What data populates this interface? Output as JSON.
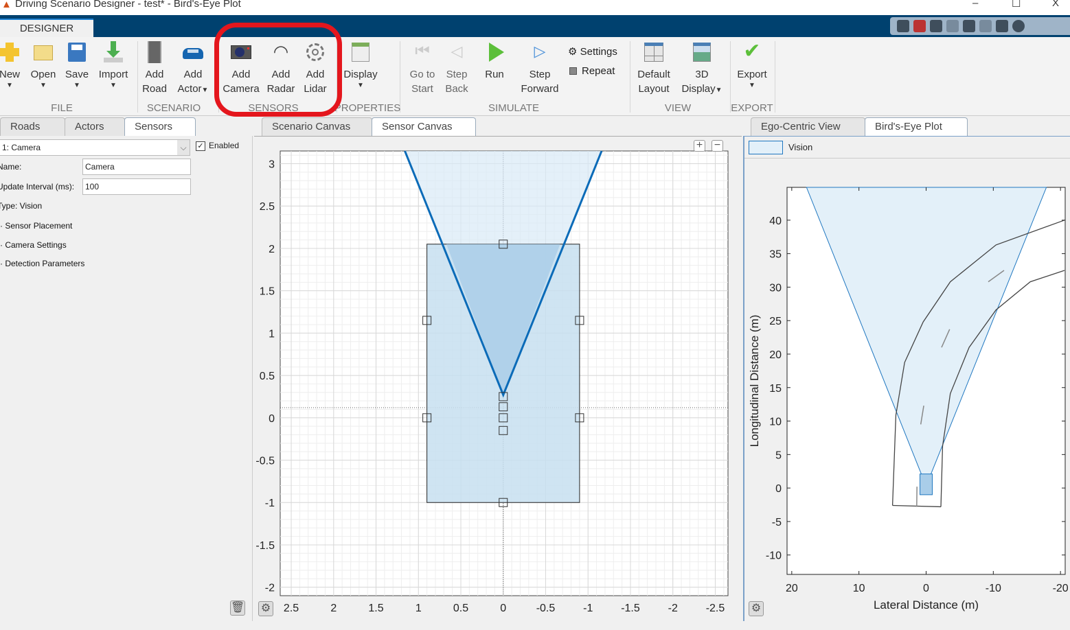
{
  "window": {
    "title": "Driving Scenario Designer - test* - Bird's-Eye Plot",
    "minimize": "–",
    "maximize": "☐",
    "close": "X"
  },
  "ribbon": {
    "tab": "DESIGNER",
    "buttons": {
      "new": "New",
      "open": "Open",
      "save": "Save",
      "import": "Import",
      "add_road_1": "Add",
      "add_road_2": "Road",
      "add_actor_1": "Add",
      "add_actor_2": "Actor",
      "add_camera_1": "Add",
      "add_camera_2": "Camera",
      "add_radar_1": "Add",
      "add_radar_2": "Radar",
      "add_lidar_1": "Add",
      "add_lidar_2": "Lidar",
      "display": "Display",
      "go_start_1": "Go to",
      "go_start_2": "Start",
      "step_back_1": "Step",
      "step_back_2": "Back",
      "run": "Run",
      "step_fwd_1": "Step",
      "step_fwd_2": "Forward",
      "settings": "Settings",
      "repeat": "Repeat",
      "default_layout_1": "Default",
      "default_layout_2": "Layout",
      "display3d_1": "3D",
      "display3d_2": "Display",
      "export": "Export"
    },
    "sections": {
      "file": "FILE",
      "scenario": "SCENARIO",
      "sensors": "SENSORS",
      "properties": "PROPERTIES",
      "simulate": "SIMULATE",
      "view": "VIEW",
      "export": "EXPORT"
    },
    "repeat_checked": false
  },
  "left_panel": {
    "tabs": [
      "Roads",
      "Actors",
      "Sensors"
    ],
    "active_tab": "Sensors",
    "sensor_select": "1: Camera",
    "enabled_label": "Enabled",
    "enabled": true,
    "name_label": "Name:",
    "name_value": "Camera",
    "interval_label": "Update Interval (ms):",
    "interval_value": "100",
    "type_label": "Type: Vision",
    "sections": [
      "Sensor Placement",
      "Camera Settings",
      "Detection Parameters"
    ]
  },
  "center_panel": {
    "tabs": [
      "Scenario Canvas",
      "Sensor Canvas"
    ],
    "active_tab": "Sensor Canvas",
    "x_ticks": [
      2.5,
      2,
      1.5,
      1,
      0.5,
      0,
      -0.5,
      -1,
      -1.5,
      -2,
      -2.5
    ],
    "y_ticks": [
      3,
      2.5,
      2,
      1.5,
      1,
      0.5,
      0,
      -0.5,
      -1,
      -1.5,
      -2
    ],
    "xlim": [
      2.63,
      -2.65
    ],
    "ylim": [
      -2.1,
      3.15
    ],
    "ego_rect": {
      "x": [
        0.9,
        -0.9
      ],
      "y": [
        -1.0,
        2.05
      ]
    },
    "cone": {
      "apex": [
        0,
        0.27
      ],
      "top_left": [
        1.16,
        3.15
      ],
      "top_right": [
        -1.16,
        3.15
      ]
    },
    "handles": [
      [
        0,
        2.05
      ],
      [
        0.9,
        1.15
      ],
      [
        -0.9,
        1.15
      ],
      [
        0.9,
        0
      ],
      [
        -0.9,
        0
      ],
      [
        0,
        -1.0
      ],
      [
        0,
        0.25
      ],
      [
        0,
        0.13
      ],
      [
        0,
        0
      ],
      [
        0,
        -0.15
      ]
    ],
    "cone_color": "#0b6bb8",
    "rect_fill": "#c7dff0"
  },
  "right_panel": {
    "tabs": [
      "Ego-Centric View",
      "Bird's-Eye Plot"
    ],
    "active_tab": "Bird's-Eye Plot",
    "legend": "Vision",
    "chart_data": {
      "type": "line",
      "xlabel": "Lateral Distance (m)",
      "ylabel": "Longitudinal Distance (m)",
      "xlim": [
        20.7,
        -20.7
      ],
      "ylim": [
        -12.9,
        44.9
      ],
      "x_ticks": [
        20,
        10,
        0,
        -10,
        -20
      ],
      "y_ticks": [
        40,
        35,
        30,
        25,
        20,
        15,
        10,
        5,
        0,
        -5,
        -10
      ],
      "coverage": {
        "name": "Vision",
        "apex": [
          0,
          0.3
        ],
        "left": [
          17.8,
          44.9
        ],
        "right": [
          -17.9,
          44.9
        ],
        "fill": "#e3f0f9",
        "stroke": "#1f77c0"
      },
      "ego": {
        "x": [
          0.92,
          -0.92
        ],
        "y": [
          -1.0,
          2.1
        ]
      },
      "road_left": [
        [
          5.0,
          -2.6
        ],
        [
          4.5,
          10.9
        ],
        [
          3.2,
          18.75
        ],
        [
          0.44,
          24.8
        ],
        [
          -3.6,
          30.8
        ],
        [
          -10.4,
          36.3
        ],
        [
          -20.6,
          40
        ]
      ],
      "road_right": [
        [
          -2.2,
          -2.8
        ],
        [
          -2.45,
          6.25
        ],
        [
          -3.6,
          14.1
        ],
        [
          -6.4,
          21
        ],
        [
          -10.4,
          26.6
        ],
        [
          -15.5,
          30.8
        ],
        [
          -20.6,
          32.5
        ]
      ],
      "lane_marks": [
        [
          [
            1.36,
            0.2
          ],
          [
            1.4,
            -2.8
          ]
        ],
        [
          [
            0.8,
            9.5
          ],
          [
            0.35,
            12.3
          ]
        ],
        [
          [
            -2.3,
            21
          ],
          [
            -3.5,
            23.7
          ]
        ],
        [
          [
            -9.25,
            30.8
          ],
          [
            -11.6,
            32.5
          ]
        ]
      ]
    }
  }
}
